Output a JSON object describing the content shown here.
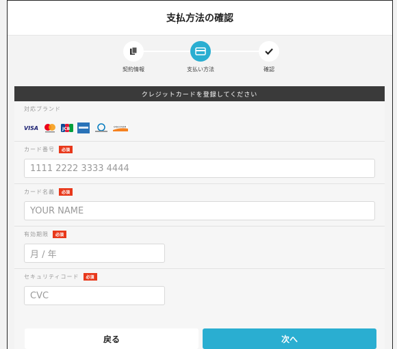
{
  "page": {
    "title": "支払方法の確認"
  },
  "steps": [
    {
      "label": "契約情報",
      "icon": "document-icon",
      "state": "done"
    },
    {
      "label": "支払い方法",
      "icon": "credit-card-icon",
      "state": "active"
    },
    {
      "label": "確認",
      "icon": "check-icon",
      "state": "pending"
    }
  ],
  "form": {
    "header": "クレジットカードを登録してください",
    "brands_label": "対応ブランド",
    "brands": [
      "VISA",
      "Mastercard",
      "JCB",
      "American Express",
      "Diners Club",
      "DISCOVER"
    ],
    "card_number": {
      "label": "カード番号",
      "required": "必須",
      "placeholder": "1111 2222 3333 4444"
    },
    "card_name": {
      "label": "カード名義",
      "required": "必須",
      "placeholder": "YOUR NAME"
    },
    "expiry": {
      "label": "有効期限",
      "required": "必須",
      "placeholder": "月 / 年"
    },
    "cvc": {
      "label": "セキュリティコード",
      "required": "必須",
      "placeholder": "CVC"
    }
  },
  "buttons": {
    "back": "戻る",
    "next": "次へ"
  },
  "colors": {
    "accent": "#2aaed1",
    "required": "#e8381b",
    "header": "#3a3a3a"
  }
}
